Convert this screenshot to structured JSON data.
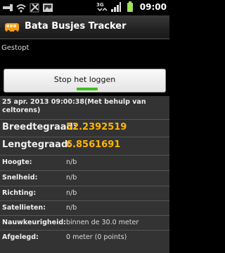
{
  "statusbar": {
    "time": "09:00",
    "icons": [
      "usb-icon",
      "wifi-icon",
      "debug-icon",
      "image-icon",
      "3g-signal-icon",
      "signal-bars-icon",
      "battery-icon"
    ]
  },
  "titlebar": {
    "title": "Bata Busjes Tracker",
    "icon": "bus-icon"
  },
  "status": "Gestopt",
  "stop_button": {
    "label": "Stop het loggen",
    "accent": "#3fbf1c"
  },
  "timestamp": "25 apr. 2013 09:00:38(Met behulp van celtorens)",
  "fields": {
    "latitude": {
      "label": "Breedtegraad:",
      "value": "52.2392519"
    },
    "longitude": {
      "label": "Lengtegraad:",
      "value": "6.8561691"
    },
    "altitude": {
      "label": "Hoogte:",
      "value": "n/b"
    },
    "speed": {
      "label": "Snelheid:",
      "value": "n/b"
    },
    "direction": {
      "label": "Richting:",
      "value": "n/b"
    },
    "satellites": {
      "label": "Satellieten:",
      "value": "n/b"
    },
    "accuracy": {
      "label": "Nauwkeurigheid:",
      "value": "binnen de 30.0 meter"
    },
    "distance": {
      "label": "Afgelegd:",
      "value": "0 meter (0 points)"
    }
  },
  "colors": {
    "value_highlight": "#ffb600",
    "panel_bg": "#333333"
  }
}
